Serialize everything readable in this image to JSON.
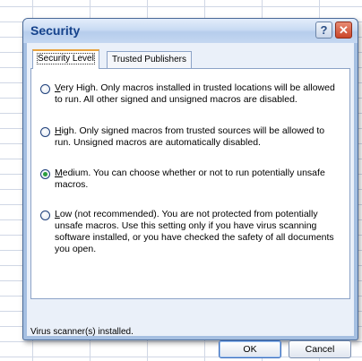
{
  "dialog": {
    "title": "Security",
    "help_glyph": "?",
    "close_glyph": "✕"
  },
  "tabs": [
    {
      "label": "Security Level",
      "active": true
    },
    {
      "label": "Trusted Publishers",
      "active": false
    }
  ],
  "options": [
    {
      "label_first": "V",
      "label_rest": "ery High. Only macros installed in trusted locations will be allowed to run. All other signed and unsigned macros are disabled.",
      "checked": false
    },
    {
      "label_first": "H",
      "label_rest": "igh. Only signed macros from trusted sources will be allowed to run. Unsigned macros are automatically disabled.",
      "checked": false
    },
    {
      "label_first": "M",
      "label_rest": "edium. You can choose whether or not to run potentially unsafe macros.",
      "checked": true
    },
    {
      "label_first": "L",
      "label_rest": "ow (not recommended). You are not protected from potentially unsafe macros. Use this setting only if you have virus scanning software installed, or you have checked the safety of all documents you open.",
      "checked": false
    }
  ],
  "status_text": "Virus scanner(s) installed.",
  "buttons": {
    "ok": "OK",
    "cancel": "Cancel"
  },
  "colors": {
    "title_text": "#15428b",
    "dialog_frame": "#a5bfe1",
    "active_tab_accent": "#e8a23c",
    "radio_checked": "#2a9d3d"
  }
}
